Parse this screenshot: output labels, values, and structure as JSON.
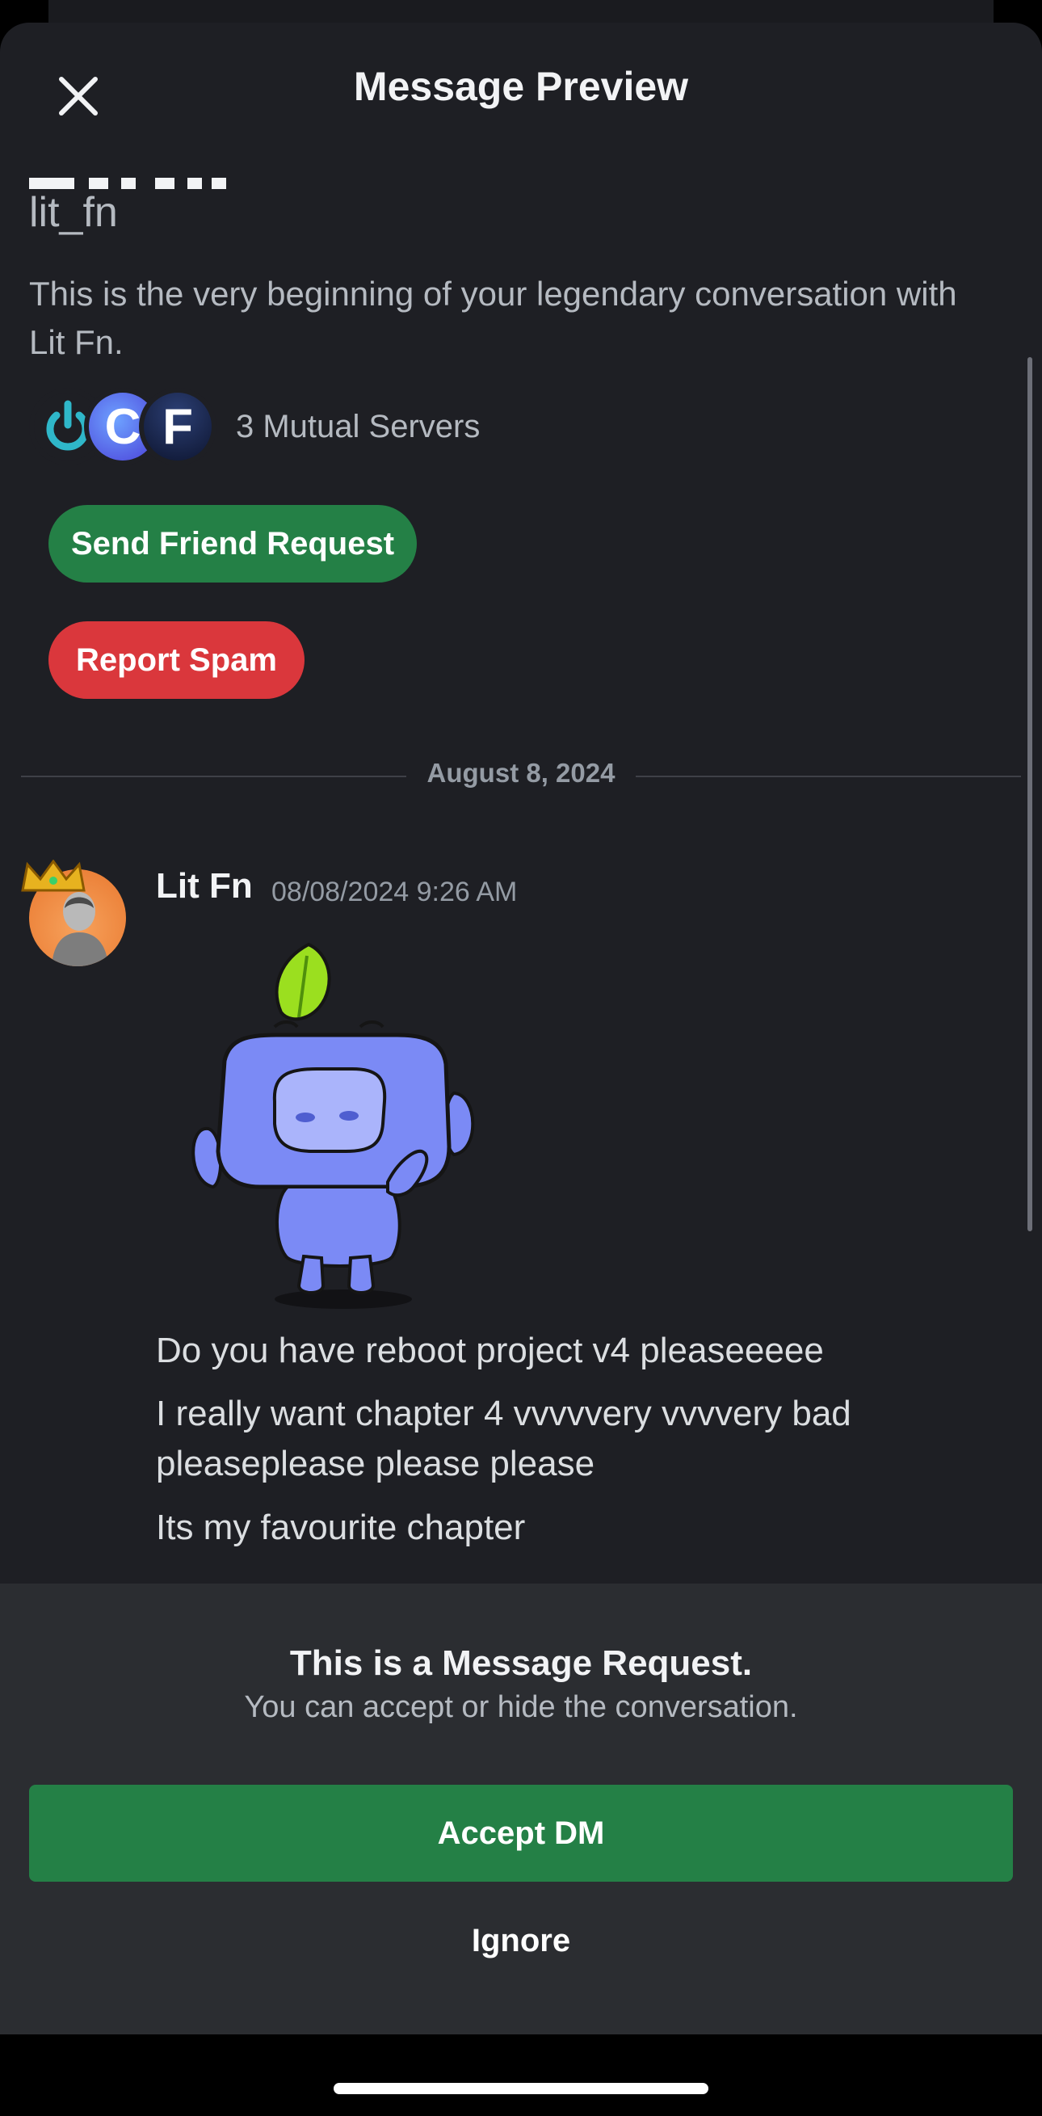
{
  "header": {
    "title": "Message Preview"
  },
  "profile": {
    "username": "lit_fn",
    "intro": "This is the very beginning of your legendary conversation with Lit Fn.",
    "mutual_servers": {
      "label": "3 Mutual Servers",
      "icons": [
        "power-swirl-server-icon",
        "C",
        "F"
      ]
    }
  },
  "actions": {
    "friend_request": "Send Friend Request",
    "report_spam": "Report Spam"
  },
  "divider": {
    "date": "August 8, 2024"
  },
  "message": {
    "author": "Lit Fn",
    "timestamp": "08/08/2024 9:26 AM",
    "sticker": "wumpus-waving-sticker",
    "lines": [
      "Do you have reboot project v4 pleaseeeee",
      "I really want chapter 4 vvvvvery vvvvery bad pleaseplease please please",
      "Its my favourite chapter"
    ]
  },
  "request": {
    "title": "This is a Message Request.",
    "subtitle": "You can accept or hide the conversation.",
    "accept_label": "Accept DM",
    "ignore_label": "Ignore"
  },
  "colors": {
    "background": "#1e1f24",
    "panel": "#2b2d31",
    "green": "#248046",
    "red": "#da373c",
    "muted_text": "#b5bac1"
  }
}
